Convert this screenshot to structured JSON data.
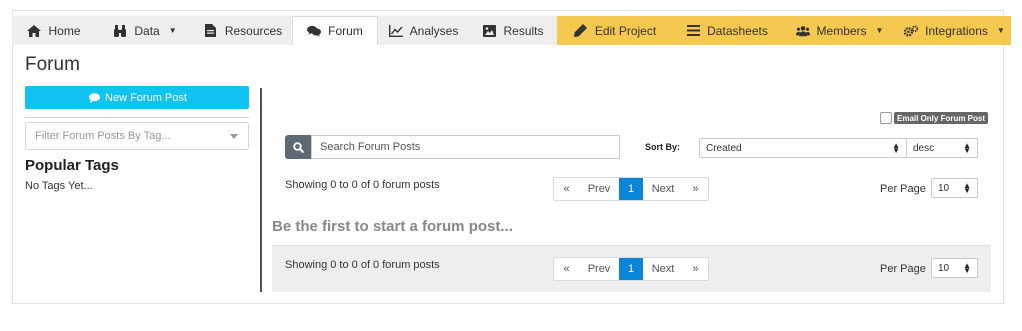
{
  "nav": {
    "tabs": [
      {
        "label": "Home",
        "icon": "home-icon"
      },
      {
        "label": "Data",
        "icon": "binoculars-icon",
        "dropdown": true
      },
      {
        "label": "Resources",
        "icon": "file-icon"
      },
      {
        "label": "Forum",
        "icon": "comments-icon",
        "active": true
      },
      {
        "label": "Analyses",
        "icon": "chart-icon"
      },
      {
        "label": "Results",
        "icon": "image-icon"
      },
      {
        "label": "Edit Project",
        "icon": "pencil-icon"
      },
      {
        "label": "Datasheets",
        "icon": "list-icon"
      },
      {
        "label": "Members",
        "icon": "users-icon",
        "dropdown": true
      },
      {
        "label": "Integrations",
        "icon": "gears-icon",
        "dropdown": true
      }
    ]
  },
  "sidebar": {
    "title": "Forum",
    "new_post_label": "New Forum Post",
    "filter_placeholder": "Filter Forum Posts By Tag...",
    "popular_title": "Popular Tags",
    "no_tags_text": "No Tags Yet..."
  },
  "main": {
    "email_only_label": "Email Only Forum Post",
    "search_placeholder": "Search Forum Posts",
    "sort_by_label": "Sort By:",
    "sort_field": "Created",
    "sort_order": "desc",
    "showing_text": "Showing 0 to 0 of 0 forum posts",
    "pager": {
      "first": "«",
      "prev": "Prev",
      "current": "1",
      "next": "Next",
      "last": "»"
    },
    "per_page_label": "Per Page",
    "per_page_value": "10",
    "empty_message": "Be the first to start a forum post..."
  },
  "colors": {
    "accent_yellow": "#f5c84f",
    "new_post_button": "#11c3f0",
    "active_page": "#0a86d8",
    "tab_gray": "#eeeeee"
  }
}
